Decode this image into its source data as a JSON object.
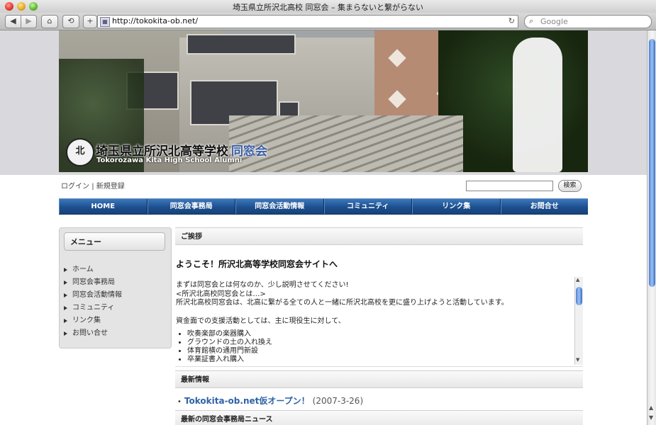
{
  "window": {
    "title": "埼玉県立所沢北高校 同窓会 – 集まらないと繋がらない"
  },
  "toolbar": {
    "back_glyph": "◀",
    "forward_glyph": "▶",
    "home_glyph": "⌂",
    "history_glyph": "⟲",
    "add_glyph": "+",
    "url": "http://tokokita-ob.net/",
    "reload_glyph": "↻",
    "search_placeholder": "Google"
  },
  "header": {
    "emblem_text": "北",
    "school_name": "埼玉県立所沢北高等学校",
    "dousoukai": "同窓会",
    "english_name": "Tokorozawa Kita High School Alumni"
  },
  "login": {
    "login_label": "ログイン",
    "separator": "|",
    "register_label": "新規登録"
  },
  "top_search": {
    "button_label": "検索"
  },
  "nav": {
    "items": [
      {
        "label": "HOME"
      },
      {
        "label": "同窓会事務局"
      },
      {
        "label": "同窓会活動情報"
      },
      {
        "label": "コミュニティ"
      },
      {
        "label": "リンク集"
      },
      {
        "label": "お問合せ"
      }
    ]
  },
  "sidebar": {
    "title": "メニュー",
    "items": [
      {
        "label": "ホーム"
      },
      {
        "label": "同窓会事務局"
      },
      {
        "label": "同窓会活動情報"
      },
      {
        "label": "コミュニティ"
      },
      {
        "label": "リンク集"
      },
      {
        "label": "お問い合せ"
      }
    ]
  },
  "greeting": {
    "section_title": "ご挨拶",
    "welcome": "ようこそ！所沢北高等学校同窓会サイトへ",
    "line1": "まずは同窓会とは何なのか、少し説明させてください!",
    "line2": "<所沢北高校同窓会とは…>",
    "line3": "所沢北高校同窓会は、北高に繋がる全ての人と一緒に所沢北高校を更に盛り上げようと活動しています。",
    "line4": "資金面での支援活動としては、主に現役生に対して、",
    "list": [
      {
        "text": "吹奏楽部の楽器購入"
      },
      {
        "text": "グラウンドの土の入れ換え"
      },
      {
        "text": "体育館横の通用門新設"
      },
      {
        "text": "卒業証書入れ購入"
      }
    ]
  },
  "news": {
    "section_title": "最新情報",
    "items": [
      {
        "title": "Tokokita-ob.net仮オープン！",
        "date": "(2007-3-26)"
      }
    ]
  },
  "office_news": {
    "section_title": "最新の同窓会事務局ニュース"
  },
  "colors": {
    "nav_blue": "#1c4f8f",
    "link_blue": "#2f62a8",
    "scroll_blue": "#4d7fd4"
  }
}
